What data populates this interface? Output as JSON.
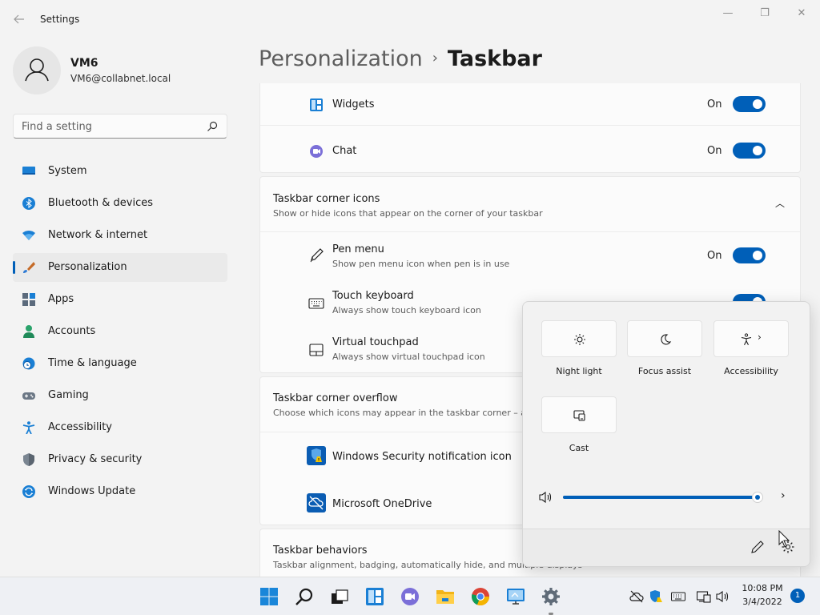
{
  "window": {
    "title": "Settings",
    "back_icon": "back-arrow-icon",
    "minimize_glyph": "—",
    "maximize_glyph": "❐",
    "close_glyph": "✕"
  },
  "profile": {
    "name": "VM6",
    "email": "VM6@collabnet.local",
    "icon": "user-avatar-icon"
  },
  "search": {
    "placeholder": "Find a setting",
    "icon": "search-icon"
  },
  "nav": [
    {
      "label": "System",
      "icon": "monitor-icon"
    },
    {
      "label": "Bluetooth & devices",
      "icon": "bluetooth-icon"
    },
    {
      "label": "Network & internet",
      "icon": "wifi-icon"
    },
    {
      "label": "Personalization",
      "icon": "paintbrush-icon",
      "active": true
    },
    {
      "label": "Apps",
      "icon": "apps-icon"
    },
    {
      "label": "Accounts",
      "icon": "person-icon"
    },
    {
      "label": "Time & language",
      "icon": "globe-clock-icon"
    },
    {
      "label": "Gaming",
      "icon": "gamepad-icon"
    },
    {
      "label": "Accessibility",
      "icon": "accessibility-icon"
    },
    {
      "label": "Privacy & security",
      "icon": "shield-icon"
    },
    {
      "label": "Windows Update",
      "icon": "update-icon"
    }
  ],
  "breadcrumb": {
    "parent": "Personalization",
    "separator": "›",
    "current": "Taskbar"
  },
  "taskbar_items": [
    {
      "title": "Widgets",
      "state": "On",
      "icon": "widgets-icon"
    },
    {
      "title": "Chat",
      "state": "On",
      "icon": "chat-icon"
    }
  ],
  "corner_icons": {
    "title": "Taskbar corner icons",
    "description": "Show or hide icons that appear on the corner of your taskbar",
    "chevron": "︿",
    "items": [
      {
        "title": "Pen menu",
        "description": "Show pen menu icon when pen is in use",
        "state": "On",
        "icon": "pen-icon"
      },
      {
        "title": "Touch keyboard",
        "description": "Always show touch keyboard icon",
        "icon": "keyboard-icon"
      },
      {
        "title": "Virtual touchpad",
        "description": "Always show virtual touchpad icon",
        "icon": "touchpad-icon"
      }
    ]
  },
  "corner_overflow": {
    "title": "Taskbar corner overflow",
    "description": "Choose which icons may appear in the taskbar corner – al",
    "items": [
      {
        "title": "Windows Security notification icon",
        "icon": "windows-security-icon"
      },
      {
        "title": "Microsoft OneDrive",
        "icon": "onedrive-icon"
      }
    ]
  },
  "behaviors": {
    "title": "Taskbar behaviors",
    "description": "Taskbar alignment, badging, automatically hide, and multiple displays"
  },
  "quick_settings": {
    "tiles": [
      {
        "label": "Night light",
        "icon": "night-light-icon"
      },
      {
        "label": "Focus assist",
        "icon": "moon-icon"
      },
      {
        "label": "Accessibility",
        "icon": "accessibility-icon",
        "chevron": "›"
      },
      {
        "label": "Cast",
        "icon": "cast-icon"
      }
    ],
    "volume": {
      "icon": "speaker-icon",
      "level": 0.97,
      "arrow": "›"
    },
    "edit_icon": "pencil-icon",
    "settings_icon": "gear-icon"
  },
  "taskbar": {
    "apps": [
      {
        "name": "start",
        "icon": "windows-logo-icon"
      },
      {
        "name": "search",
        "icon": "search-icon"
      },
      {
        "name": "task-view",
        "icon": "task-view-icon"
      },
      {
        "name": "widgets",
        "icon": "widgets-icon"
      },
      {
        "name": "chat",
        "icon": "chat-icon"
      },
      {
        "name": "file-explorer",
        "icon": "folder-icon"
      },
      {
        "name": "chrome",
        "icon": "chrome-icon"
      },
      {
        "name": "remote-desktop",
        "icon": "remote-desktop-icon"
      },
      {
        "name": "settings",
        "icon": "gear-icon",
        "running": true
      }
    ],
    "tray": [
      "onedrive-offline-icon",
      "windows-security-icon",
      "keyboard-icon",
      "network-icon",
      "speaker-icon"
    ],
    "time": "10:08 PM",
    "date": "3/4/2022",
    "notification_count": "1"
  },
  "colors": {
    "accent": "#005fb8",
    "background": "#f3f3f3",
    "card": "#fbfbfb"
  }
}
